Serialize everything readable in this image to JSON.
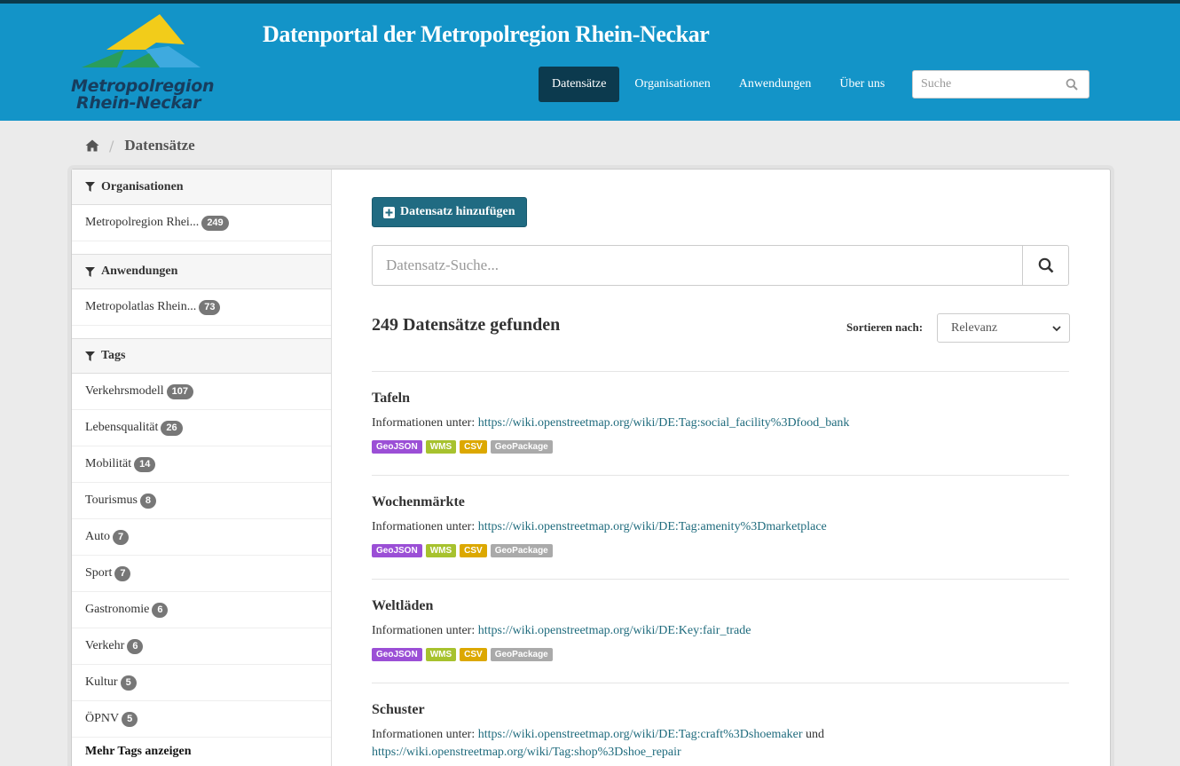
{
  "header": {
    "title": "Datenportal der Metropolregion Rhein-Neckar",
    "logo_line1": "Metropolregion",
    "logo_line2": "Rhein-Neckar",
    "nav": [
      {
        "label": "Datensätze",
        "active": true
      },
      {
        "label": "Organisationen",
        "active": false
      },
      {
        "label": "Anwendungen",
        "active": false
      },
      {
        "label": "Über uns",
        "active": false
      }
    ],
    "search_placeholder": "Suche",
    "colors": {
      "bar": "#1394c8",
      "active_nav": "#0c3a4e"
    }
  },
  "breadcrumb": {
    "current": "Datensätze"
  },
  "sidebar": {
    "organisationen": {
      "heading": "Organisationen",
      "items": [
        {
          "label": "Metropolregion Rhei...",
          "count": "249"
        }
      ]
    },
    "anwendungen": {
      "heading": "Anwendungen",
      "items": [
        {
          "label": "Metropolatlas Rhein...",
          "count": "73"
        }
      ]
    },
    "tags": {
      "heading": "Tags",
      "items": [
        {
          "label": "Verkehrsmodell",
          "count": "107"
        },
        {
          "label": "Lebensqualität",
          "count": "26"
        },
        {
          "label": "Mobilität",
          "count": "14"
        },
        {
          "label": "Tourismus",
          "count": "8"
        },
        {
          "label": "Auto",
          "count": "7"
        },
        {
          "label": "Sport",
          "count": "7"
        },
        {
          "label": "Gastronomie",
          "count": "6"
        },
        {
          "label": "Verkehr",
          "count": "6"
        },
        {
          "label": "Kultur",
          "count": "5"
        },
        {
          "label": "ÖPNV",
          "count": "5"
        }
      ],
      "more": "Mehr Tags anzeigen"
    }
  },
  "main": {
    "add_button": "Datensatz hinzufügen",
    "search_placeholder": "Datensatz-Suche...",
    "results_title": "249 Datensätze gefunden",
    "sort_label": "Sortieren nach:",
    "sort_value": "Relevanz",
    "info_prefix": "Informationen unter:",
    "datasets": [
      {
        "title": "Tafeln",
        "link": "https://wiki.openstreetmap.org/wiki/DE:Tag:social_facility%3Dfood_bank",
        "formats": [
          "GeoJSON",
          "WMS",
          "CSV",
          "GeoPackage"
        ]
      },
      {
        "title": "Wochenmärkte",
        "link": "https://wiki.openstreetmap.org/wiki/DE:Tag:amenity%3Dmarketplace",
        "formats": [
          "GeoJSON",
          "WMS",
          "CSV",
          "GeoPackage"
        ]
      },
      {
        "title": "Weltläden",
        "link": "https://wiki.openstreetmap.org/wiki/DE:Key:fair_trade",
        "formats": [
          "GeoJSON",
          "WMS",
          "CSV",
          "GeoPackage"
        ]
      },
      {
        "title": "Schuster",
        "link": "https://wiki.openstreetmap.org/wiki/DE:Tag:craft%3Dshoemaker",
        "link_joiner": "und",
        "link2": "https://wiki.openstreetmap.org/wiki/Tag:shop%3Dshoe_repair",
        "formats": []
      }
    ],
    "format_colors": {
      "GeoJSON": "#9b4fd6",
      "WMS": "#a7c22e",
      "CSV": "#dca800",
      "GeoPackage": "#aaaaaa"
    }
  }
}
